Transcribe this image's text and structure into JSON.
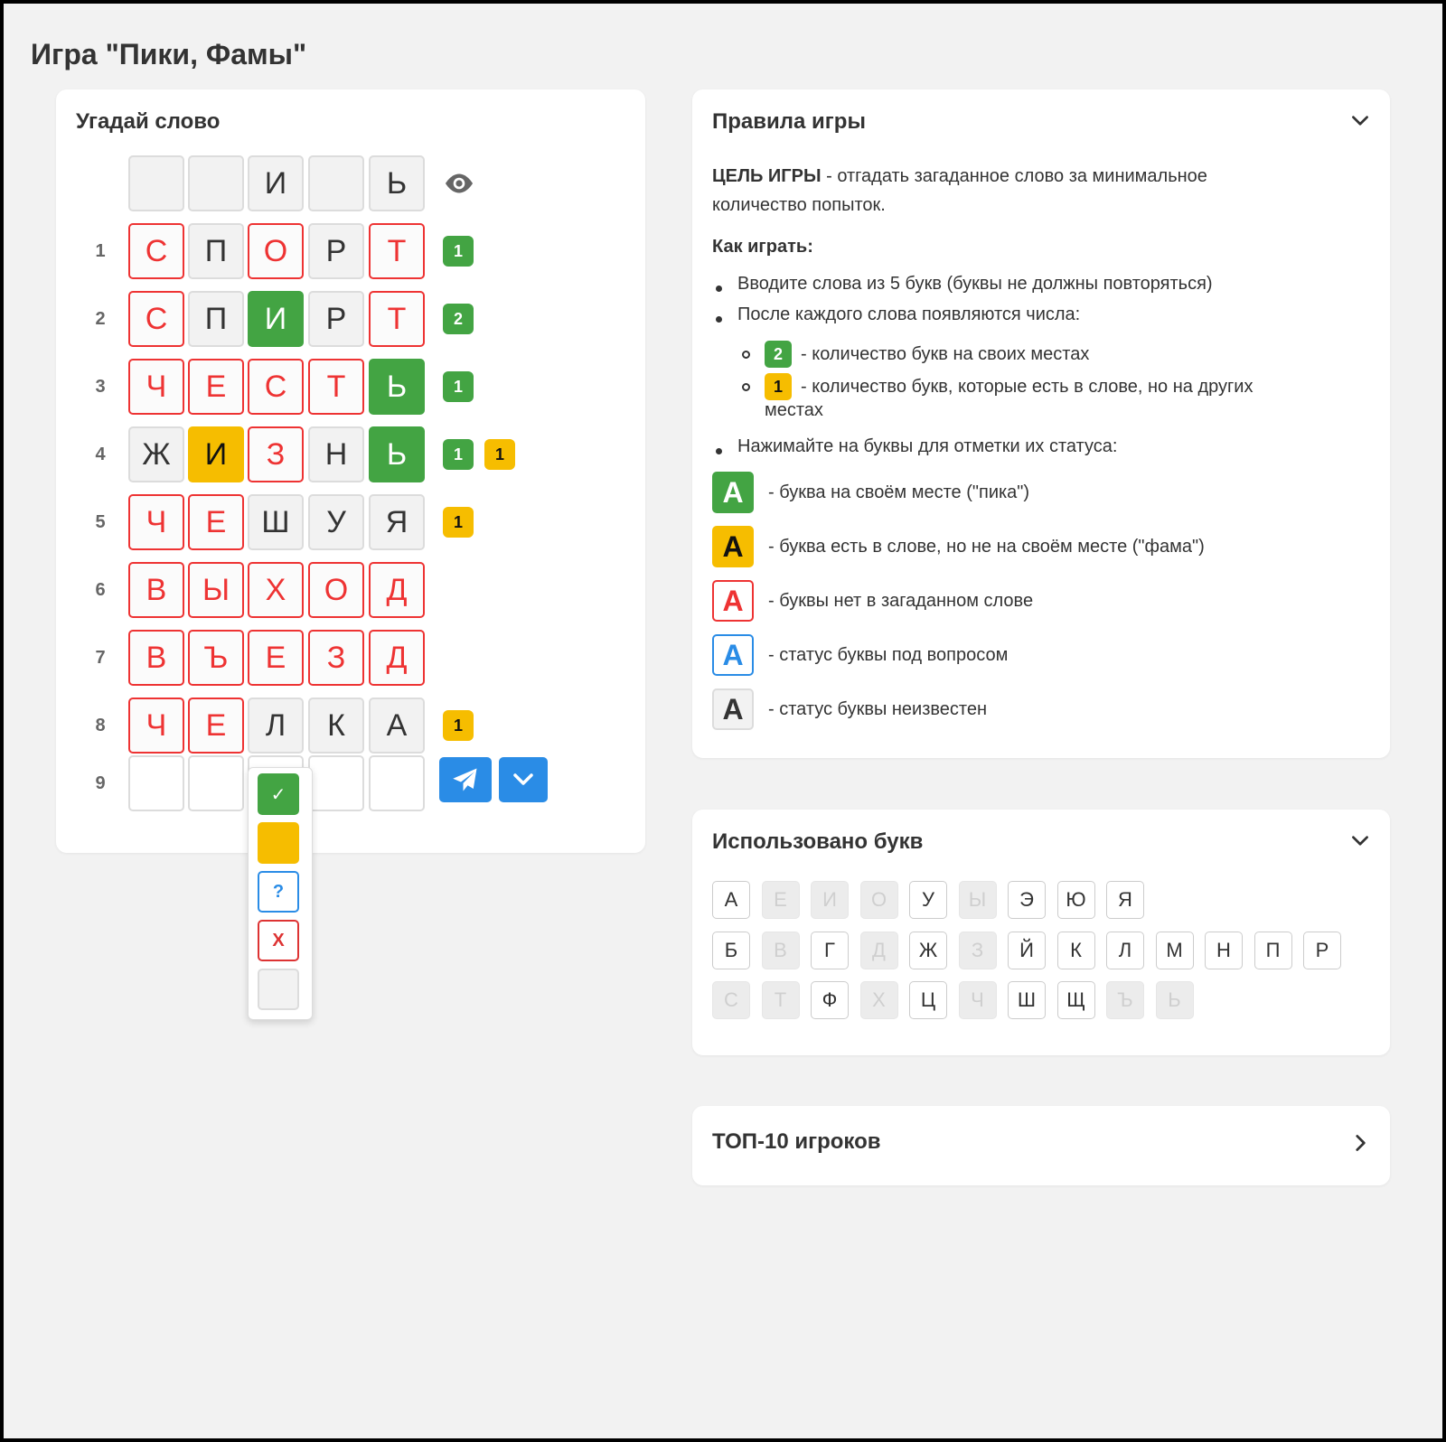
{
  "page_title": "Игра \"Пики, Фамы\"",
  "game": {
    "title": "Угадай слово",
    "answer_row": [
      {
        "letter": "",
        "status": "unknown"
      },
      {
        "letter": "",
        "status": "unknown"
      },
      {
        "letter": "И",
        "status": "unknown"
      },
      {
        "letter": "",
        "status": "unknown"
      },
      {
        "letter": "Ь",
        "status": "unknown"
      }
    ],
    "reveal_icon": "eye-icon",
    "guesses": [
      {
        "num": "1",
        "cells": [
          [
            "С",
            "red"
          ],
          [
            "П",
            "gray"
          ],
          [
            "О",
            "red"
          ],
          [
            "Р",
            "gray"
          ],
          [
            "Т",
            "red"
          ]
        ],
        "badges": [
          [
            "1",
            "g"
          ]
        ]
      },
      {
        "num": "2",
        "cells": [
          [
            "С",
            "red"
          ],
          [
            "П",
            "gray"
          ],
          [
            "И",
            "green"
          ],
          [
            "Р",
            "gray"
          ],
          [
            "Т",
            "red"
          ]
        ],
        "badges": [
          [
            "2",
            "g"
          ]
        ]
      },
      {
        "num": "3",
        "cells": [
          [
            "Ч",
            "red"
          ],
          [
            "Е",
            "red"
          ],
          [
            "С",
            "red"
          ],
          [
            "Т",
            "red"
          ],
          [
            "Ь",
            "green"
          ]
        ],
        "badges": [
          [
            "1",
            "g"
          ]
        ]
      },
      {
        "num": "4",
        "cells": [
          [
            "Ж",
            "gray"
          ],
          [
            "И",
            "yellow"
          ],
          [
            "З",
            "red"
          ],
          [
            "Н",
            "gray"
          ],
          [
            "Ь",
            "green"
          ]
        ],
        "badges": [
          [
            "1",
            "g"
          ],
          [
            "1",
            "y"
          ]
        ]
      },
      {
        "num": "5",
        "cells": [
          [
            "Ч",
            "red"
          ],
          [
            "Е",
            "red"
          ],
          [
            "Ш",
            "gray"
          ],
          [
            "У",
            "gray"
          ],
          [
            "Я",
            "gray"
          ]
        ],
        "badges": [
          [
            "1",
            "y"
          ]
        ]
      },
      {
        "num": "6",
        "cells": [
          [
            "В",
            "red"
          ],
          [
            "Ы",
            "red"
          ],
          [
            "Х",
            "red"
          ],
          [
            "О",
            "red"
          ],
          [
            "Д",
            "red"
          ]
        ],
        "badges": []
      },
      {
        "num": "7",
        "cells": [
          [
            "В",
            "red"
          ],
          [
            "Ъ",
            "red"
          ],
          [
            "Е",
            "red"
          ],
          [
            "З",
            "red"
          ],
          [
            "Д",
            "red"
          ]
        ],
        "badges": []
      },
      {
        "num": "8",
        "cells": [
          [
            "Ч",
            "red"
          ],
          [
            "Е",
            "red"
          ],
          [
            "Л",
            "gray"
          ],
          [
            "К",
            "gray"
          ],
          [
            "А",
            "gray"
          ]
        ],
        "badges": [
          [
            "1",
            "y"
          ]
        ]
      }
    ],
    "input_row": {
      "num": "9"
    },
    "send_icon": "send-icon",
    "expand_icon": "chevron-down-icon",
    "status_menu": {
      "options": [
        {
          "name": "status-option-green",
          "label": "✓"
        },
        {
          "name": "status-option-yellow",
          "label": ""
        },
        {
          "name": "status-option-question",
          "label": "?"
        },
        {
          "name": "status-option-cross",
          "label": "X"
        },
        {
          "name": "status-option-unknown",
          "label": ""
        }
      ]
    }
  },
  "rules": {
    "title": "Правила игры",
    "goal_bold": "ЦЕЛЬ ИГРЫ",
    "goal_line1": " - отгадать загаданное слово за минимальное",
    "goal_line2": "количество попыток.",
    "how_title": "Как играть:",
    "bullet1": "Вводите слова из 5 букв (буквы не должны повторяться)",
    "bullet2": "После каждого слова появляются числа:",
    "sub1_badge": "2",
    "sub1_text": "- количество букв на своих местах",
    "sub2_badge": "1",
    "sub2_line1": "- количество букв, которые есть в слове, но на других",
    "sub2_line2": "местах",
    "bullet3": "Нажимайте на буквы для отметки их статуса:",
    "legend": [
      {
        "letter": "А",
        "type": "green",
        "text": "- буква на своём месте (\"пика\")"
      },
      {
        "letter": "А",
        "type": "yellow",
        "text": "- буква есть в слове, но не на своём месте (\"фама\")"
      },
      {
        "letter": "А",
        "type": "red",
        "text": "- буквы нет в загаданном слове"
      },
      {
        "letter": "А",
        "type": "blue",
        "text": "- статус буквы под вопросом"
      },
      {
        "letter": "А",
        "type": "gray",
        "text": "- статус буквы неизвестен"
      }
    ]
  },
  "used_letters": {
    "title": "Использовано букв",
    "rows": [
      [
        [
          "А",
          false
        ],
        [
          "Е",
          true
        ],
        [
          "И",
          true
        ],
        [
          "О",
          true
        ],
        [
          "У",
          false
        ],
        [
          "Ы",
          true
        ],
        [
          "Э",
          false
        ],
        [
          "Ю",
          false
        ],
        [
          "Я",
          false
        ]
      ],
      [
        [
          "Б",
          false
        ],
        [
          "В",
          true
        ],
        [
          "Г",
          false
        ],
        [
          "Д",
          true
        ],
        [
          "Ж",
          false
        ],
        [
          "З",
          true
        ],
        [
          "Й",
          false
        ],
        [
          "К",
          false
        ],
        [
          "Л",
          false
        ],
        [
          "М",
          false
        ],
        [
          "Н",
          false
        ],
        [
          "П",
          false
        ],
        [
          "Р",
          false
        ]
      ],
      [
        [
          "С",
          true
        ],
        [
          "Т",
          true
        ],
        [
          "Ф",
          false
        ],
        [
          "Х",
          true
        ],
        [
          "Ц",
          false
        ],
        [
          "Ч",
          true
        ],
        [
          "Ш",
          false
        ],
        [
          "Щ",
          false
        ],
        [
          "Ъ",
          true
        ],
        [
          "Ь",
          true
        ]
      ]
    ]
  },
  "top_players": {
    "title": "ТОП-10 игроков"
  }
}
